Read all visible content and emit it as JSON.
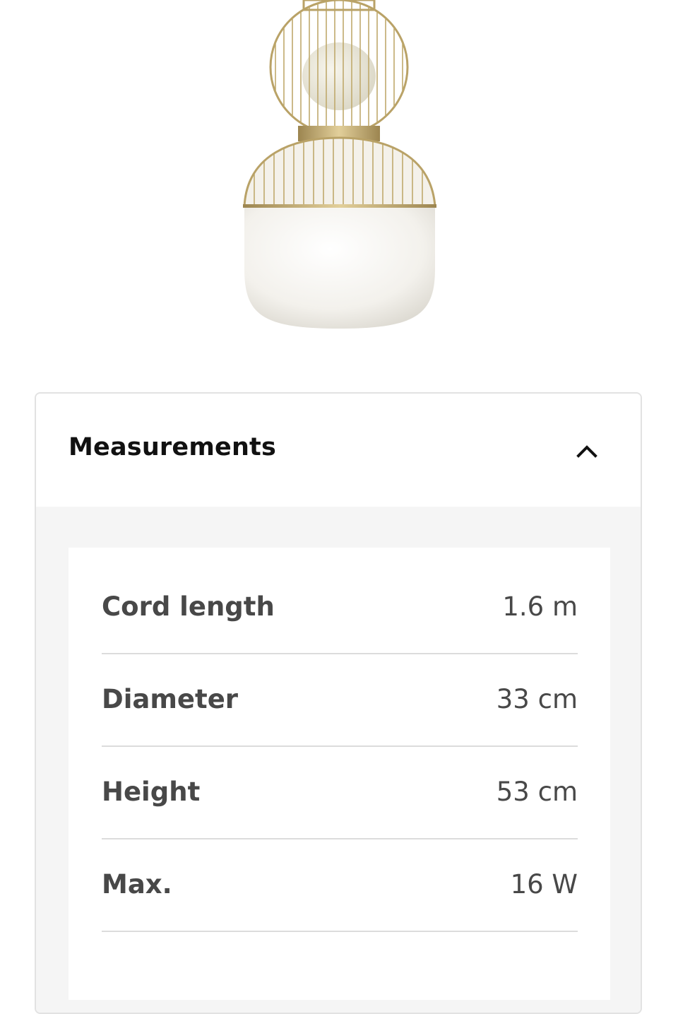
{
  "product": {
    "image_name": "gold-cage-pendant-lamp"
  },
  "measurements": {
    "title": "Measurements",
    "toggle_icon": "chevron-up-icon",
    "expanded": true,
    "rows": [
      {
        "label": "Cord length",
        "value": "1.6 m"
      },
      {
        "label": "Diameter",
        "value": "33 cm"
      },
      {
        "label": "Height",
        "value": "53 cm"
      },
      {
        "label": "Max.",
        "value": "16 W"
      }
    ]
  },
  "colors": {
    "brass": "#c9b27a",
    "text_dark": "#111111",
    "text_gray": "#484848",
    "panel_bg": "#f5f5f5",
    "divider": "#dcdcdc"
  }
}
